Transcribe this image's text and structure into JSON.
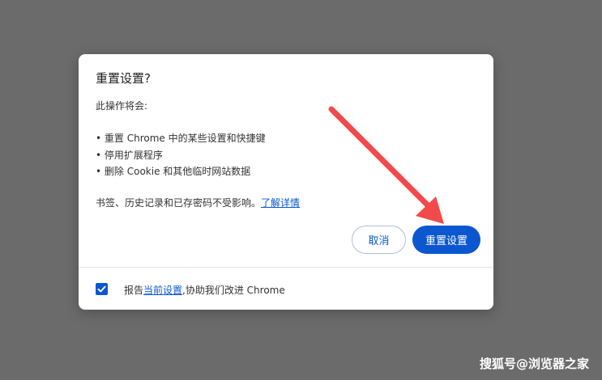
{
  "dialog": {
    "title": "重置设置?",
    "intro": "此操作将会:",
    "bullets": [
      "重置 Chrome 中的某些设置和快捷键",
      "停用扩展程序",
      "删除 Cookie 和其他临时网站数据"
    ],
    "note_text": "书签、历史记录和已存密码不受影响。",
    "note_link": "了解详情",
    "cancel_label": "取消",
    "reset_label": "重置设置",
    "report_prefix": "报告",
    "report_link": "当前设置",
    "report_suffix": ",协助我们改进 Chrome",
    "report_checked": true
  },
  "colors": {
    "accent": "#0b57d0",
    "arrow": "#f24a4a",
    "backdrop": "#6b6b6b"
  },
  "icons": {
    "checkbox": "checkmark-icon",
    "annotation": "arrow-icon"
  },
  "watermark": "搜狐号@浏览器之家"
}
